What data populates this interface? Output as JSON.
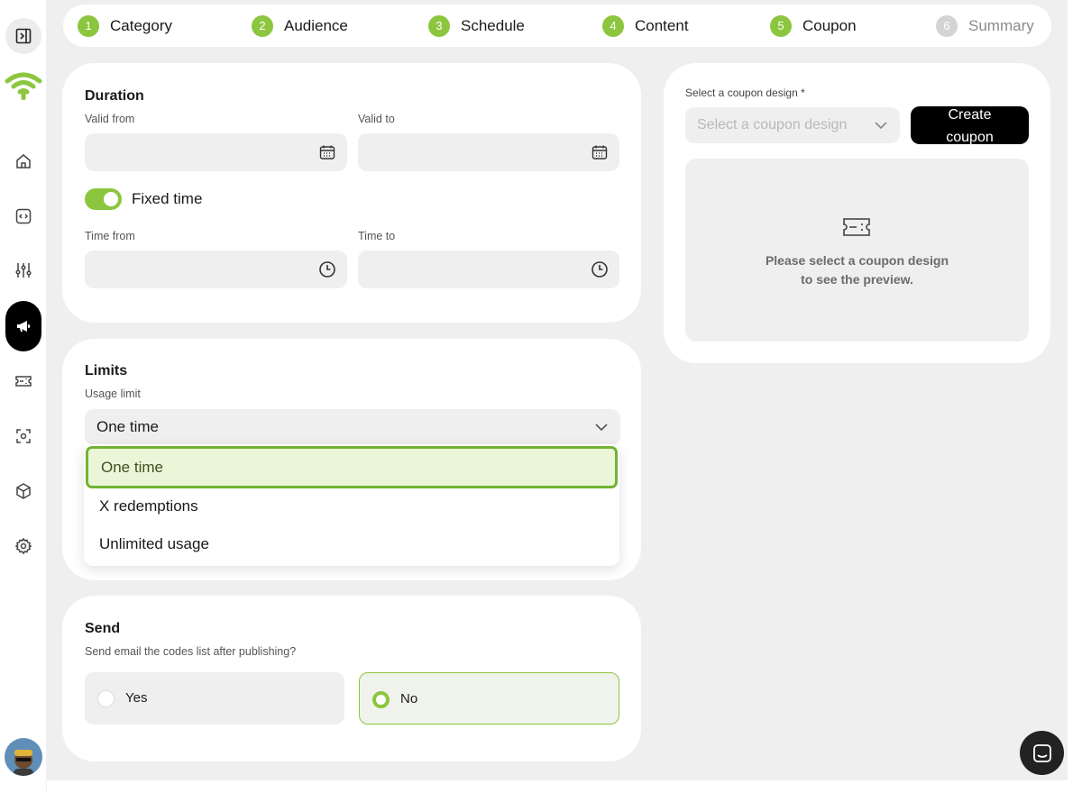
{
  "stepper": {
    "steps": [
      {
        "num": "1",
        "label": "Category"
      },
      {
        "num": "2",
        "label": "Audience"
      },
      {
        "num": "3",
        "label": "Schedule"
      },
      {
        "num": "4",
        "label": "Content"
      },
      {
        "num": "5",
        "label": "Coupon"
      },
      {
        "num": "6",
        "label": "Summary"
      }
    ]
  },
  "duration": {
    "title": "Duration",
    "valid_from_label": "Valid from",
    "valid_to_label": "Valid to",
    "fixed_time_label": "Fixed time",
    "fixed_time_on": true,
    "time_from_label": "Time from",
    "time_to_label": "Time to"
  },
  "limits": {
    "title": "Limits",
    "usage_limit_label": "Usage limit",
    "selected": "One time",
    "options": [
      "One time",
      "X redemptions",
      "Unlimited usage"
    ]
  },
  "send": {
    "title": "Send",
    "question": "Send email the codes list after publishing?",
    "yes_label": "Yes",
    "no_label": "No",
    "selected": "No"
  },
  "coupon": {
    "design_label": "Select a coupon design *",
    "design_placeholder": "Select a coupon design",
    "create_button_label": "Create coupon",
    "preview_line1": "Please select a coupon design",
    "preview_line2": "to see the preview."
  },
  "colors": {
    "accent": "#8cc63f",
    "accent_dark": "#73b335",
    "background": "#efefef"
  },
  "icons": [
    "sidebar-toggle-icon",
    "wifi-logo-icon",
    "home-icon",
    "code-icon",
    "sliders-icon",
    "megaphone-icon",
    "ticket-icon",
    "scan-icon",
    "box-icon",
    "gear-icon",
    "calendar-icon",
    "clock-icon",
    "chevron-down-icon",
    "chat-icon"
  ]
}
